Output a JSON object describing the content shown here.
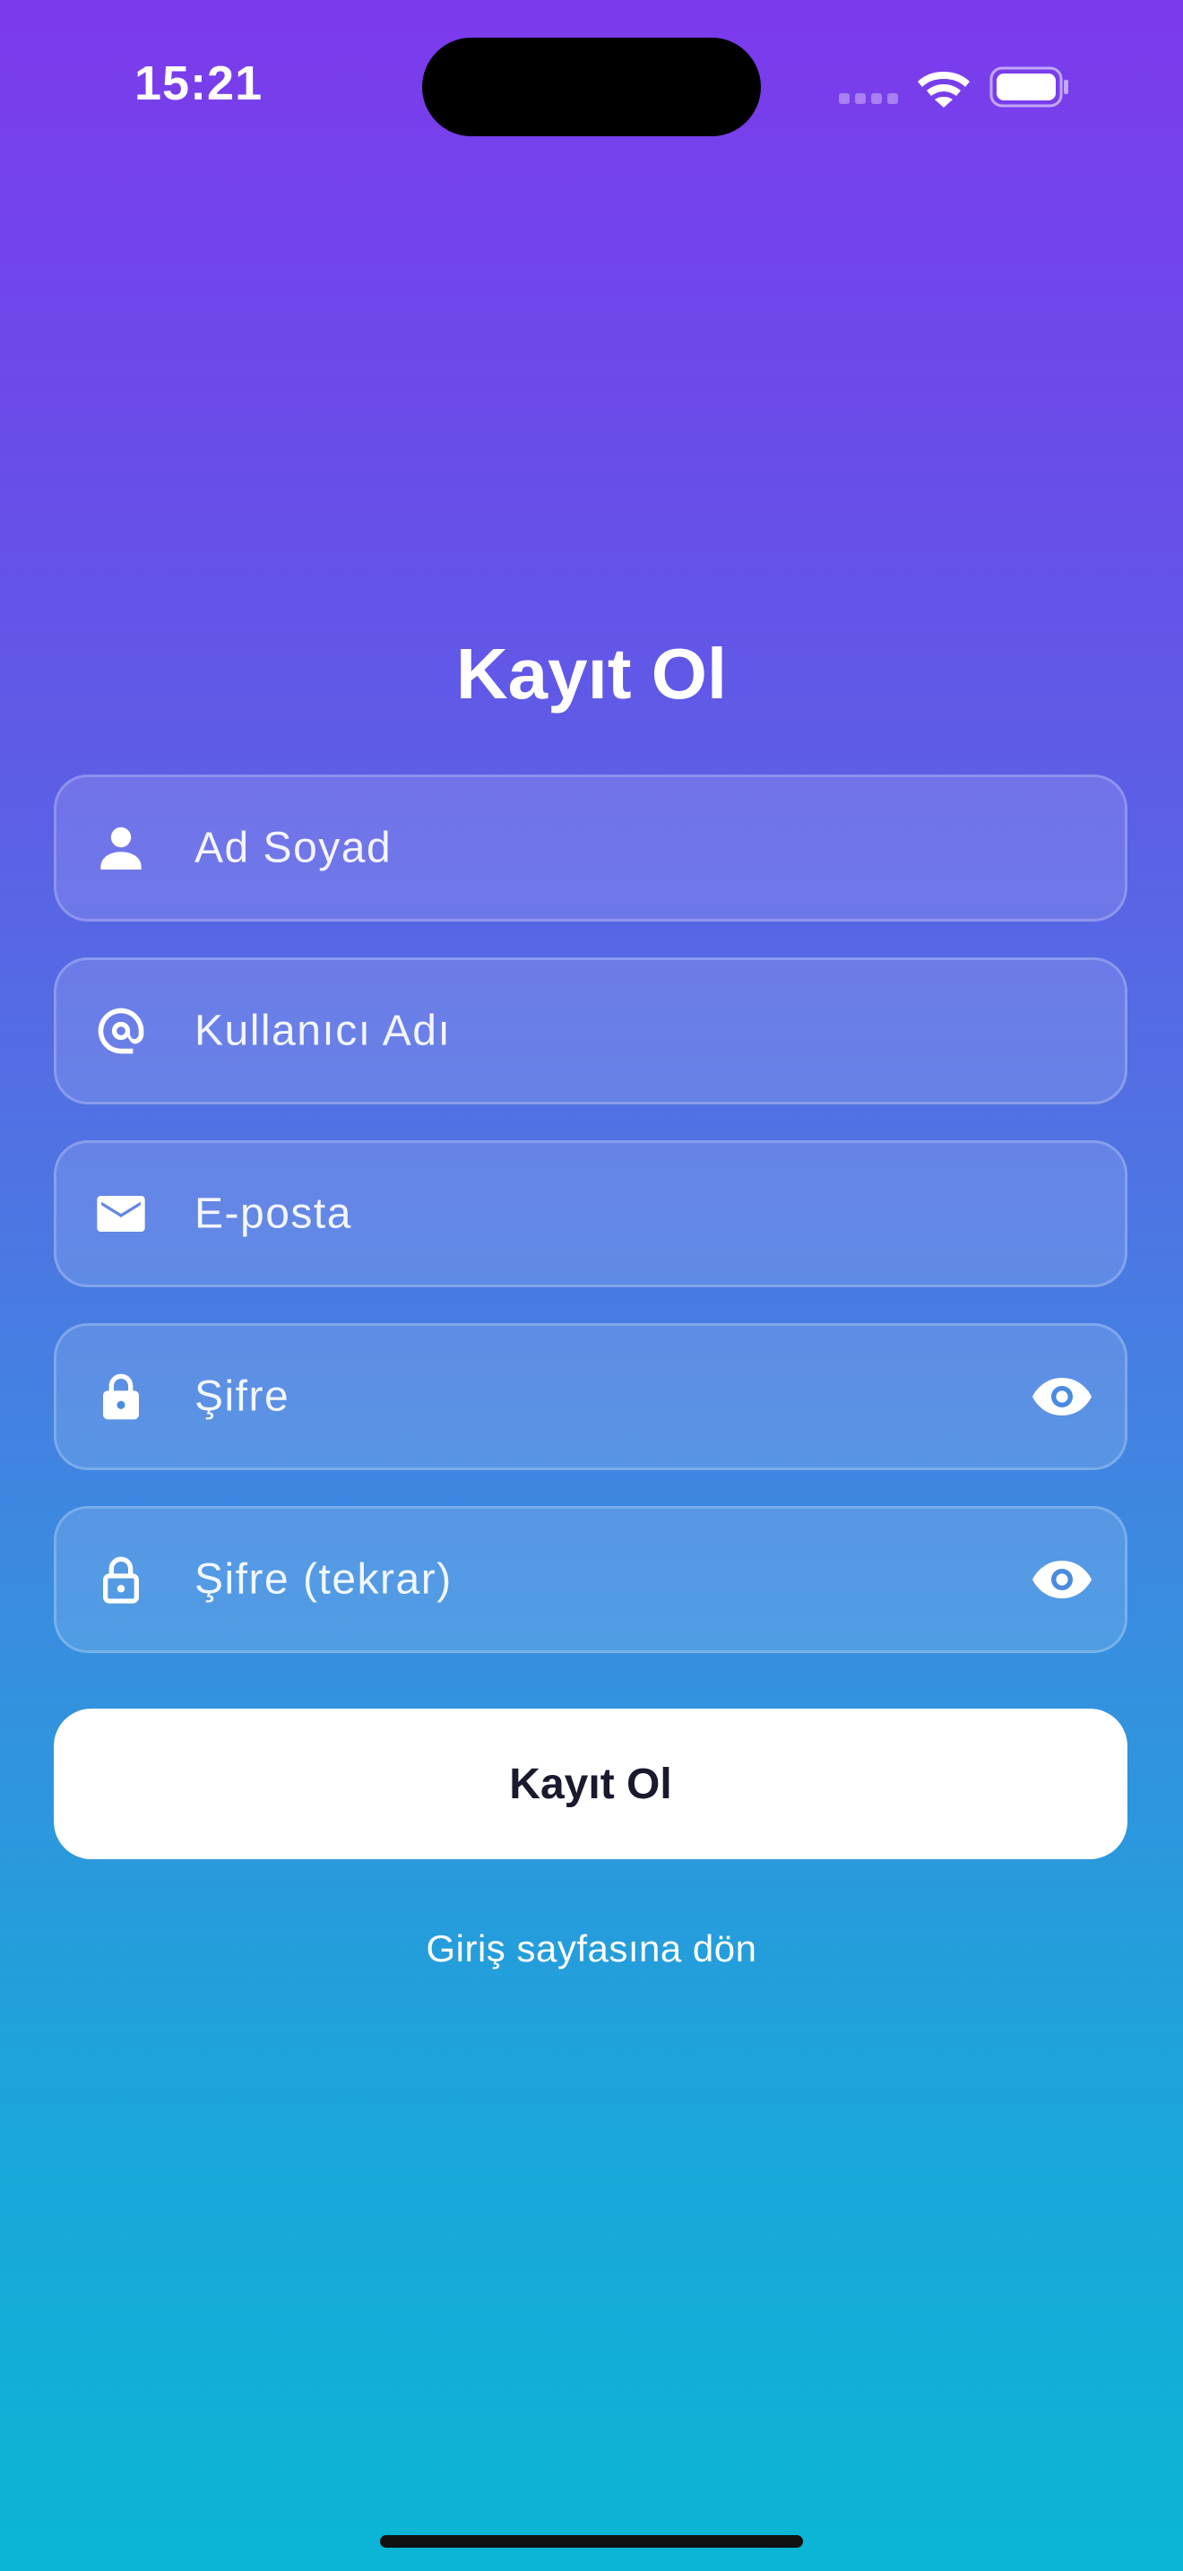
{
  "status_bar": {
    "time": "15:21"
  },
  "title": "Kayıt Ol",
  "form": {
    "fields": [
      {
        "placeholder": "Ad Soyad",
        "icon": "person-icon"
      },
      {
        "placeholder": "Kullanıcı Adı",
        "icon": "at-icon"
      },
      {
        "placeholder": "E-posta",
        "icon": "envelope-icon"
      },
      {
        "placeholder": "Şifre",
        "icon": "lock-icon",
        "toggle_icon": "eye-icon"
      },
      {
        "placeholder": "Şifre (tekrar)",
        "icon": "lock-outline-icon",
        "toggle_icon": "eye-icon"
      }
    ],
    "submit_label": "Kayıt Ol",
    "back_link": "Giriş sayfasına dön"
  },
  "colors": {
    "gradient_top": "#7c3aed",
    "gradient_bottom": "#0bb5d6",
    "button_bg": "#ffffff",
    "button_text": "#1a1a2e",
    "eye_icon_accent": "#4a8be0"
  }
}
